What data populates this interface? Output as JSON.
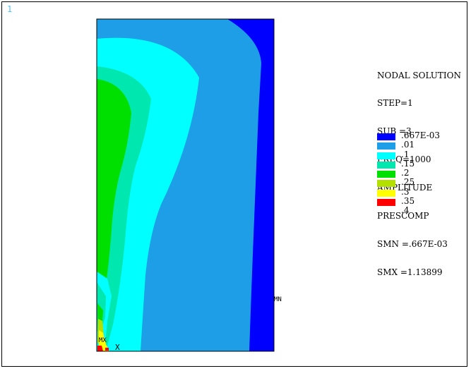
{
  "window": {
    "id": "1"
  },
  "legend": {
    "lines": [
      "NODAL SOLUTION",
      "STEP=1",
      "SUB =3",
      "FREQ=1000",
      "AMPLITUDE",
      "PRESCOMP",
      "SMN =.667E-03",
      "SMX =1.13899"
    ],
    "contours": [
      {
        "label": ".667E-03",
        "color": "#0000ff"
      },
      {
        "label": ".01",
        "color": "#1e9ee6"
      },
      {
        "label": ".1",
        "color": "#00ffff"
      },
      {
        "label": ".15",
        "color": "#00e8b0"
      },
      {
        "label": ".2",
        "color": "#00e000"
      },
      {
        "label": ".25",
        "color": "#b4e000"
      },
      {
        "label": ".3",
        "color": "#ffff00"
      },
      {
        "label": ".35",
        "color": "#ff0000"
      },
      {
        "label": ".4",
        "color": ""
      }
    ]
  },
  "markers": {
    "min": "MN",
    "max": "MX",
    "axis": "X"
  }
}
